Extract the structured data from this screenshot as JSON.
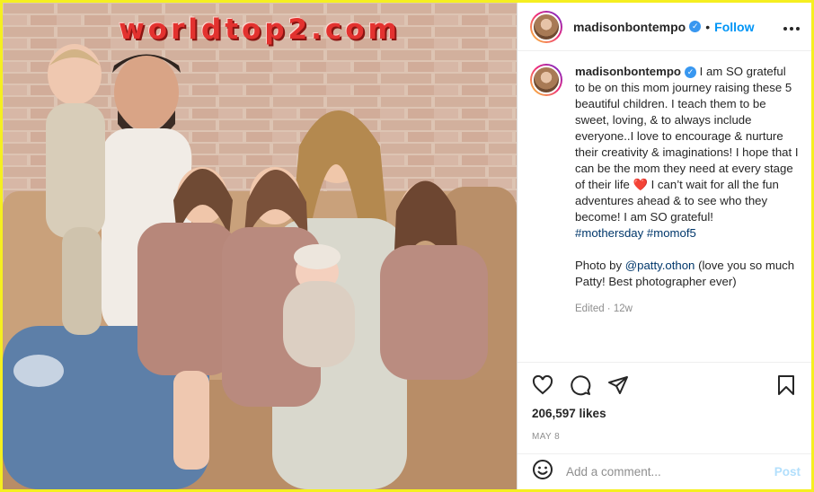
{
  "watermark": "worldtop2.com",
  "post": {
    "username": "madisonbontempo",
    "follow_label": "Follow",
    "separator": "•",
    "more_label": "•••",
    "caption_text": "I am SO grateful to be on this mom journey raising these 5 beautiful children. I teach them to be sweet, loving, & to always include everyone..I love to encourage & nurture their creativity & imaginations! I hope that I can be the mom they need at every stage of their life",
    "heart": "❤️",
    "caption_text_2": "I can’t wait for all the fun adventures ahead & to see who they become! I am SO grateful!",
    "hashtags": [
      "#mothersday",
      "#momof5"
    ],
    "credit_prefix": "Photo by",
    "credit_mention": "@patty.othon",
    "credit_suffix": "(love you so much Patty! Best photographer ever)",
    "edited": "Edited · 12w",
    "likes": "206,597 likes",
    "date": "MAY 8",
    "comment_placeholder": "Add a comment...",
    "post_label": "Post"
  },
  "colors": {
    "accent": "#0095f6",
    "border_frame": "#f5ef20",
    "hashtag": "#00376b",
    "watermark": "#e3322f"
  },
  "icons": [
    "verified-badge-icon",
    "more-options-icon",
    "heart-icon",
    "comment-icon",
    "share-icon",
    "bookmark-icon",
    "emoji-icon"
  ]
}
